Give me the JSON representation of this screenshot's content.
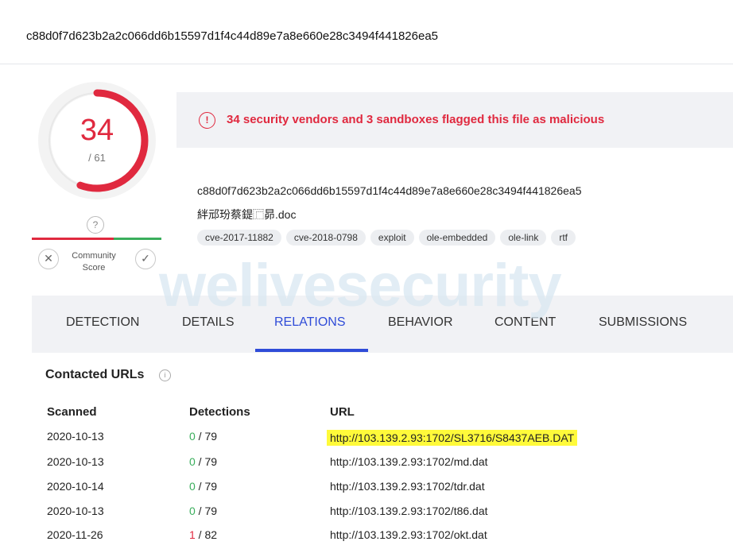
{
  "header": {
    "hash": "c88d0f7d623b2a2c066dd6b15597d1f4c44d89e7a8e660e28c3494f441826ea5"
  },
  "score": {
    "detections": "34",
    "total": "/ 61",
    "ratio": 0.557,
    "color": "#e0293f"
  },
  "community": {
    "question": "?",
    "label_line1": "Community",
    "label_line2": "Score",
    "down_symbol": "✕",
    "up_symbol": "✓"
  },
  "alert": {
    "icon": "!",
    "text": "34 security vendors and 3 sandboxes flagged this file as malicious"
  },
  "file": {
    "hash": "c88d0f7d623b2a2c066dd6b15597d1f4c44d89e7a8e660e28c3494f441826ea5",
    "name": "絆邧玢蔡鍉⿸昴.doc",
    "tags": [
      "cve-2017-11882",
      "cve-2018-0798",
      "exploit",
      "ole-embedded",
      "ole-link",
      "rtf"
    ]
  },
  "watermark": "welivesecurity",
  "tabs": [
    {
      "label": "DETECTION",
      "active": false
    },
    {
      "label": "DETAILS",
      "active": false
    },
    {
      "label": "RELATIONS",
      "active": true
    },
    {
      "label": "BEHAVIOR",
      "active": false
    },
    {
      "label": "CONTENT",
      "active": false
    },
    {
      "label": "SUBMISSIONS",
      "active": false
    }
  ],
  "contacted": {
    "title": "Contacted URLs",
    "info_icon": "i",
    "columns": {
      "scanned": "Scanned",
      "detections": "Detections",
      "url": "URL"
    },
    "rows": [
      {
        "scanned": "2020-10-13",
        "det": "0",
        "tot": " / 79",
        "url": "http://103.139.2.93:1702/SL3716/S8437AEB.DAT",
        "highlighted": true
      },
      {
        "scanned": "2020-10-13",
        "det": "0",
        "tot": " / 79",
        "url": "http://103.139.2.93:1702/md.dat",
        "highlighted": false
      },
      {
        "scanned": "2020-10-14",
        "det": "0",
        "tot": " / 79",
        "url": "http://103.139.2.93:1702/tdr.dat",
        "highlighted": false
      },
      {
        "scanned": "2020-10-13",
        "det": "0",
        "tot": " / 79",
        "url": "http://103.139.2.93:1702/t86.dat",
        "highlighted": false
      },
      {
        "scanned": "2020-11-26",
        "det": "1",
        "tot": " / 82",
        "url": "http://103.139.2.93:1702/okt.dat",
        "highlighted": false
      }
    ]
  }
}
